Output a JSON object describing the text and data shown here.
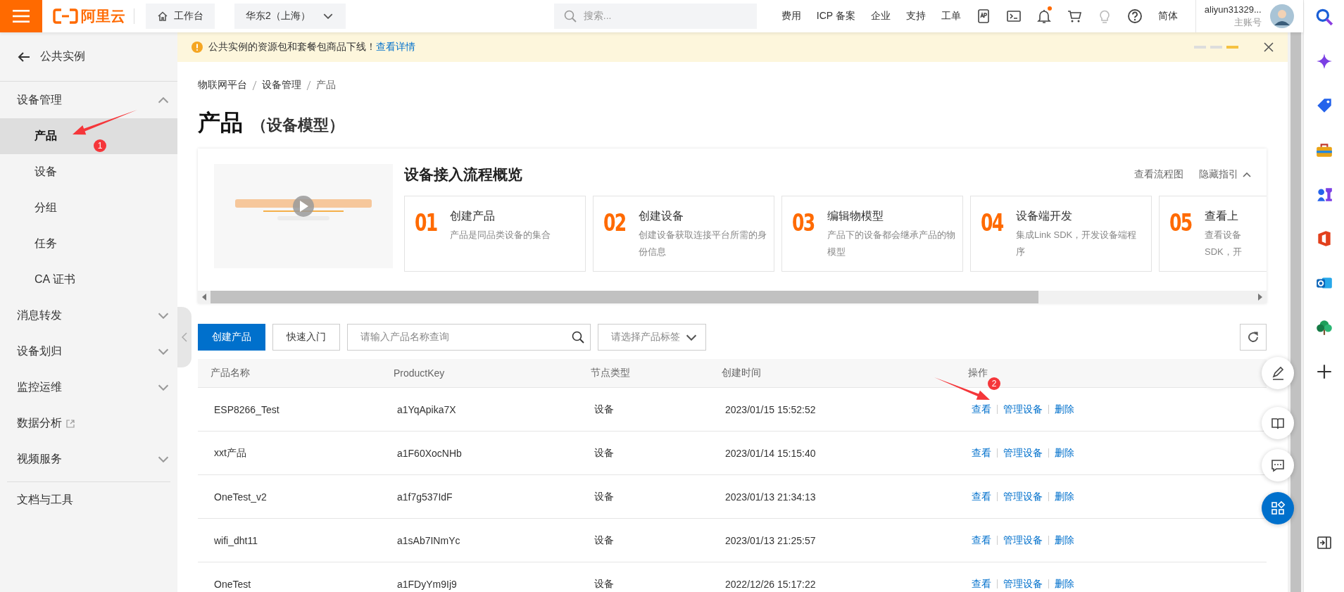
{
  "topbar": {
    "logo": "阿里云",
    "workbench": "工作台",
    "region": "华东2（上海）",
    "search": {
      "placeholder": "搜索..."
    },
    "nav": [
      "费用",
      "ICP 备案",
      "企业",
      "支持",
      "工单"
    ],
    "tools": [
      {
        "kind": "app",
        "badge": false
      },
      {
        "kind": "terminal",
        "badge": false
      },
      {
        "kind": "bell",
        "badge": true
      },
      {
        "kind": "cart",
        "badge": false
      },
      {
        "kind": "bulb",
        "badge": false
      },
      {
        "kind": "help",
        "badge": false
      }
    ],
    "language": "简体",
    "account": {
      "name": "aliyun31329...",
      "role": "主账号"
    }
  },
  "sidebar": {
    "back": "公共实例",
    "items": [
      {
        "label": "设备管理",
        "kind": "group",
        "expanded": true,
        "children": [
          {
            "label": "产品",
            "selected": true
          },
          {
            "label": "设备",
            "selected": false
          },
          {
            "label": "分组",
            "selected": false
          },
          {
            "label": "任务",
            "selected": false
          },
          {
            "label": "CA 证书",
            "selected": false
          }
        ]
      },
      {
        "label": "消息转发",
        "kind": "group",
        "expanded": false
      },
      {
        "label": "设备划归",
        "kind": "group",
        "expanded": false
      },
      {
        "label": "监控运维",
        "kind": "group",
        "expanded": false
      },
      {
        "label": "数据分析",
        "kind": "external"
      },
      {
        "label": "视频服务",
        "kind": "group",
        "expanded": false
      },
      {
        "label": "文档与工具",
        "kind": "footer"
      }
    ]
  },
  "notice": {
    "text": "公共实例的资源包和套餐包商品下线！",
    "link": "查看详情",
    "pages": [
      {
        "selected": false
      },
      {
        "selected": false
      },
      {
        "selected": true
      }
    ]
  },
  "breadcrumb": [
    "物联网平台",
    "设备管理",
    "产品"
  ],
  "title": "产品",
  "subtitle": "（设备模型）",
  "guide": {
    "title": "设备接入流程概览",
    "links": [
      "查看流程图",
      "隐藏指引"
    ],
    "video": {
      "kind": "picture"
    },
    "steps": [
      {
        "number": "01",
        "title": "创建产品",
        "desc": "产品是同品类设备的集合"
      },
      {
        "number": "02",
        "title": "创建设备",
        "desc": "创建设备获取连接平台所需的身份信息"
      },
      {
        "number": "03",
        "title": "编辑物模型",
        "desc": "产品下的设备都会继承产品的物模型"
      },
      {
        "number": "04",
        "title": "设备端开发",
        "desc": "集成Link SDK，开发设备端程序"
      },
      {
        "number": "05",
        "title": "查看上",
        "desc": "查看设备\nSDK，开"
      }
    ]
  },
  "toolbar": {
    "create": "创建产品",
    "quickstart": "快速入门",
    "search": {
      "placeholder": "请输入产品名称查询"
    },
    "tag_select": {
      "placeholder": "请选择产品标签"
    }
  },
  "table": {
    "columns": [
      "产品名称",
      "ProductKey",
      "节点类型",
      "创建时间",
      "操作"
    ],
    "rows": [
      {
        "name": "ESP8266_Test",
        "key": "a1YqApika7X",
        "type": "设备",
        "created": "2023/01/15 15:52:52",
        "actions": [
          "查看",
          "管理设备",
          "删除"
        ]
      },
      {
        "name": "xxt产品",
        "key": "a1F60XocNHb",
        "type": "设备",
        "created": "2023/01/14 15:15:40",
        "actions": [
          "查看",
          "管理设备",
          "删除"
        ]
      },
      {
        "name": "OneTest_v2",
        "key": "a1f7g537IdF",
        "type": "设备",
        "created": "2023/01/13 21:34:13",
        "actions": [
          "查看",
          "管理设备",
          "删除"
        ]
      },
      {
        "name": "wifi_dht11",
        "key": "a1sAb7INmYc",
        "type": "设备",
        "created": "2023/01/13 21:25:57",
        "actions": [
          "查看",
          "管理设备",
          "删除"
        ]
      },
      {
        "name": "OneTest",
        "key": "a1FDyYm9Ij9",
        "type": "设备",
        "created": "2022/12/26 15:17:22",
        "actions": [
          "查看",
          "管理设备",
          "删除"
        ]
      }
    ]
  },
  "annotations": [
    {
      "label": "1"
    },
    {
      "label": "2"
    }
  ]
}
